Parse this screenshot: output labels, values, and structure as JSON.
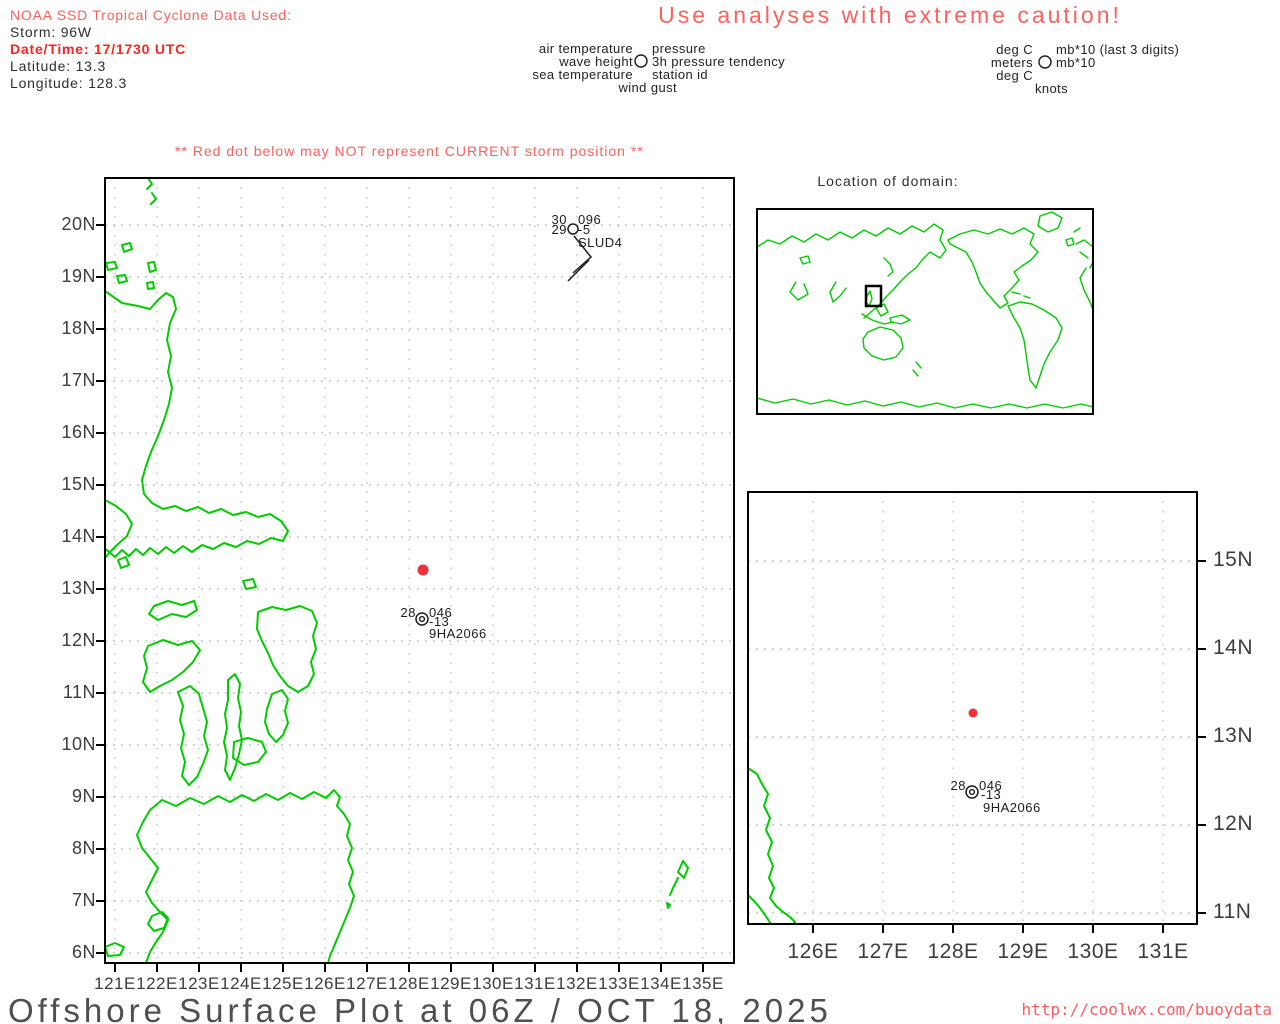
{
  "header": {
    "source_line": "NOAA SSD Tropical Cyclone Data Used:",
    "storm_line": "Storm: 96W",
    "datetime_line": "Date/Time: 17/1730 UTC",
    "latitude_line": "Latitude: 13.3",
    "longitude_line": "Longitude: 128.3",
    "caution": "Use analyses with extreme caution!"
  },
  "legend_symbols": {
    "row1_left": "air temperature",
    "row1_right": "pressure",
    "row2_left": "wave height",
    "row2_right": "3h pressure tendency",
    "row3_left": "sea temperature",
    "row3_right": "station id",
    "row4": "wind gust"
  },
  "legend_units": {
    "row1_left": "deg C",
    "row1_right": "mb*10 (last 3 digits)",
    "row2_left": "meters",
    "row2_right": "mb*10",
    "row3_left": "deg C",
    "row4": "knots"
  },
  "warning": "** Red dot below may NOT represent CURRENT storm position **",
  "main_map": {
    "lat_labels": [
      "20N",
      "19N",
      "18N",
      "17N",
      "16N",
      "15N",
      "14N",
      "13N",
      "12N",
      "11N",
      "10N",
      "9N",
      "8N",
      "7N",
      "6N"
    ],
    "lon_labels": [
      "121E",
      "122E",
      "123E",
      "124E",
      "125E",
      "126E",
      "127E",
      "128E",
      "129E",
      "130E",
      "131E",
      "132E",
      "133E",
      "134E",
      "135E"
    ],
    "storm_marker": {
      "lat": 13.3,
      "lon": 128.3
    }
  },
  "stations": {
    "slud4": {
      "air_temp": "30",
      "pressure": "096",
      "wave_height": "29",
      "tendency": "-5",
      "id": "SLUD4"
    },
    "ha2066": {
      "air_temp": "28",
      "pressure": "046",
      "tendency": "-13",
      "id": "9HA2066"
    }
  },
  "inset": {
    "title": "Location of domain:"
  },
  "zoom_map": {
    "lon_labels": [
      "126E",
      "127E",
      "128E",
      "129E",
      "130E",
      "131E"
    ],
    "lat_labels": [
      "15N",
      "14N",
      "13N",
      "12N",
      "11N"
    ],
    "storm_marker": {
      "lat": 13.3,
      "lon": 128.3
    }
  },
  "footer": {
    "title": "Offshore Surface Plot at 06Z / OCT 18, 2025",
    "url": "http://coolwx.com/buoydata"
  },
  "colors": {
    "land": "#00cc00",
    "alert_red": "#ff6161",
    "storm_dot": "#ee3338",
    "grid": "#aaaaaa"
  }
}
